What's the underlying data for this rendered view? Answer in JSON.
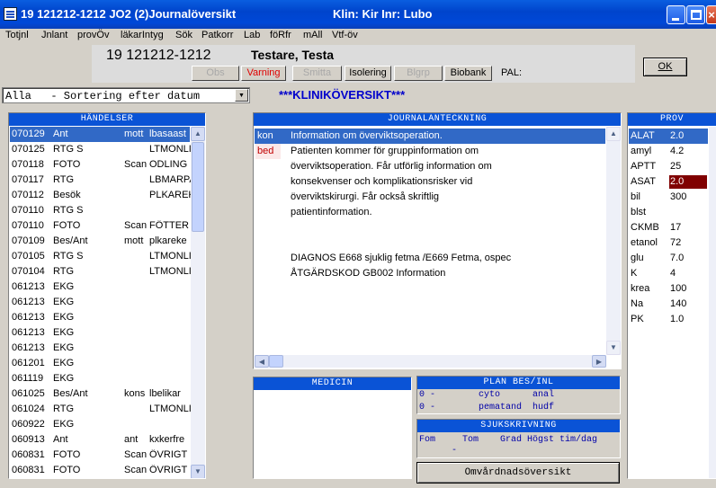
{
  "window": {
    "title": "19 121212-1212   JO2 (2)Journalöversikt",
    "klin": "Klin: Kir  Inr: Lubo"
  },
  "menu": [
    "Totjnl",
    "Jnlant",
    "provÖv",
    "läkarIntyg",
    "Sök",
    "Patkorr",
    "Lab",
    "föRfr",
    "mAll",
    "Vtf-öv"
  ],
  "patient": {
    "pnr": "19 121212-1212",
    "name": "Testare, Testa",
    "buttons": [
      "Obs",
      "Varning",
      "Smitta",
      "Isolering",
      "Blgrp",
      "Biobank"
    ],
    "pal_label": "PAL:"
  },
  "ok_label": "OK",
  "sort": {
    "value": "Alla   - Sortering efter datum"
  },
  "section_title": "***KLINIKÖVERSIKT***",
  "handelser": {
    "header": "HÄNDELSER",
    "rows": [
      [
        "070129",
        "Ant",
        "mott",
        "lbasaast"
      ],
      [
        "070125",
        "RTG S",
        "",
        "LTMONLI"
      ],
      [
        "070118",
        "FOTO",
        "Scan",
        "ODLING"
      ],
      [
        "070117",
        "RTG",
        "",
        "LBMARPA"
      ],
      [
        "070112",
        "Besök",
        "",
        "PLKAREK"
      ],
      [
        "070110",
        "RTG S",
        "",
        ""
      ],
      [
        "070110",
        "FOTO",
        "Scan",
        "FÖTTER"
      ],
      [
        "070109",
        "Bes/Ant",
        "mott",
        "plkareke"
      ],
      [
        "070105",
        "RTG S",
        "",
        "LTMONLI"
      ],
      [
        "070104",
        "RTG",
        "",
        "LTMONLI"
      ],
      [
        "061213",
        "EKG",
        "",
        ""
      ],
      [
        "061213",
        "EKG",
        "",
        ""
      ],
      [
        "061213",
        "EKG",
        "",
        ""
      ],
      [
        "061213",
        "EKG",
        "",
        ""
      ],
      [
        "061213",
        "EKG",
        "",
        ""
      ],
      [
        "061201",
        "EKG",
        "",
        ""
      ],
      [
        "061119",
        "EKG",
        "",
        ""
      ],
      [
        "061025",
        "Bes/Ant",
        "kons",
        "lbelikar"
      ],
      [
        "061024",
        "RTG",
        "",
        "LTMONLI"
      ],
      [
        "060922",
        "EKG",
        "",
        ""
      ],
      [
        "060913",
        "Ant",
        "ant",
        "kxkerfre"
      ],
      [
        "060831",
        "FOTO",
        "Scan",
        "ÖVRIGT"
      ],
      [
        "060831",
        "FOTO",
        "Scan",
        "ÖVRIGT"
      ]
    ]
  },
  "journal": {
    "header": "JOURNALANTECKNING",
    "rows": [
      [
        "kon",
        "Information om överviktsoperation."
      ],
      [
        "bed",
        "Patienten kommer för gruppinformation om"
      ],
      [
        "",
        "överviktsoperation. Får utförlig information om"
      ],
      [
        "",
        "konsekvenser och komplikationsrisker vid"
      ],
      [
        "",
        "överviktskirurgi. Får också skriftlig"
      ],
      [
        "",
        "patientinformation."
      ],
      [
        "",
        ""
      ],
      [
        "",
        ""
      ],
      [
        "",
        "DIAGNOS E668 sjuklig fetma   /E669 Fetma, ospec"
      ],
      [
        "",
        "ÅTGÄRDSKOD GB002 Information"
      ]
    ]
  },
  "prov": {
    "header": "PROV",
    "rows": [
      [
        "ALAT",
        "2.0"
      ],
      [
        "amyl",
        "4.2"
      ],
      [
        "APTT",
        "25"
      ],
      [
        "ASAT",
        "2.0"
      ],
      [
        "bil",
        "300"
      ],
      [
        "blst",
        ""
      ],
      [
        "CKMB",
        "17"
      ],
      [
        "etanol",
        "72"
      ],
      [
        "glu",
        "7.0"
      ],
      [
        "K",
        "4"
      ],
      [
        "krea",
        "100"
      ],
      [
        "Na",
        "140"
      ],
      [
        "PK",
        "1.0"
      ]
    ]
  },
  "medicin": {
    "header": "MEDICIN"
  },
  "plan": {
    "header": "PLAN BES/INL",
    "lines": [
      "0 -        cyto      anal",
      "0 -        pematand  hudf"
    ]
  },
  "sjuk": {
    "header": "SJUKSKRIVNING",
    "line1": "Fom     Tom    Grad Högst tim/dag",
    "line2": "      -"
  },
  "omv_label": "Omvårdnadsöversikt",
  "colors": {
    "accent": "#0a53d6",
    "selection": "#3169c6",
    "warning": "#e00000",
    "abnormal": "#800000"
  }
}
